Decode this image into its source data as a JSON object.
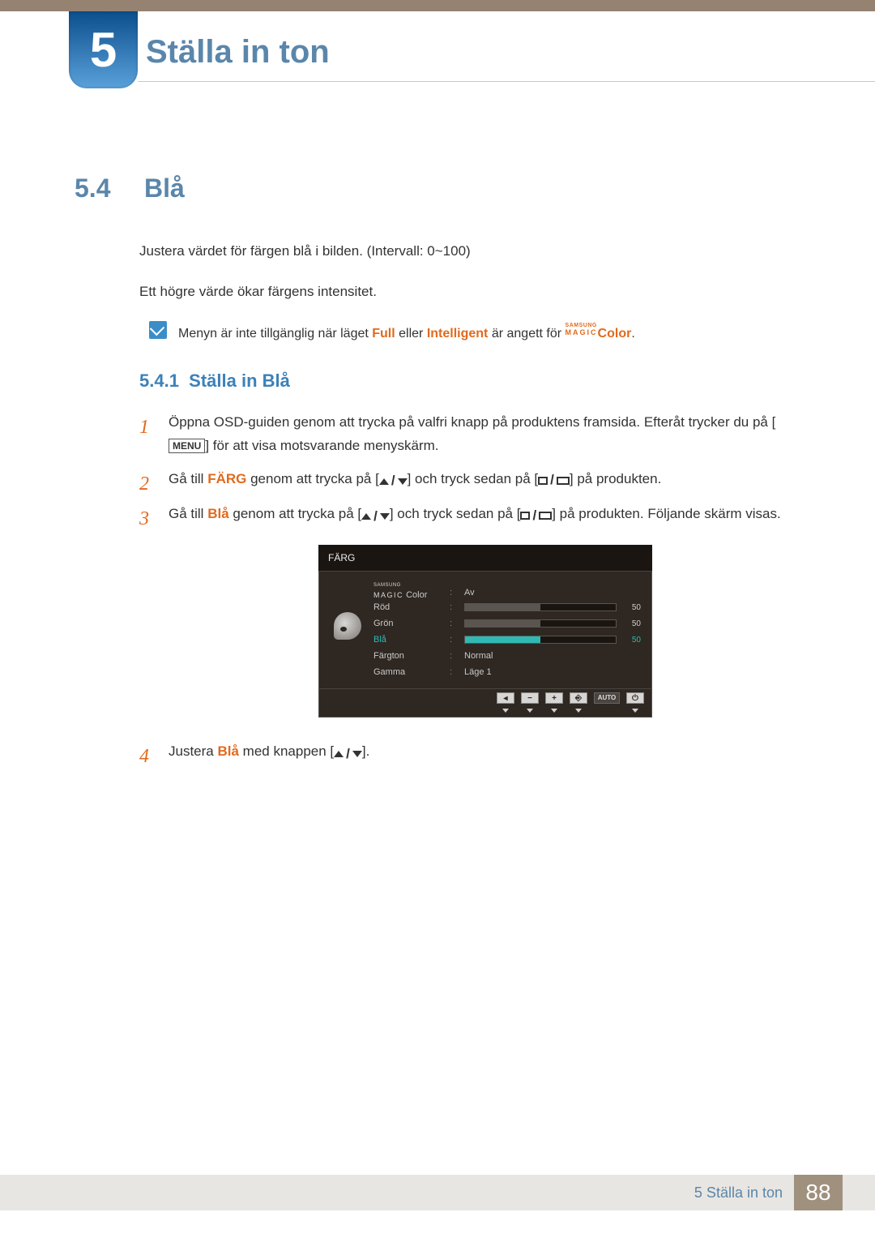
{
  "chapter": {
    "number": "5",
    "title": "Ställa in ton"
  },
  "section": {
    "number": "5.4",
    "title": "Blå"
  },
  "intro": {
    "p1": "Justera värdet för färgen blå i bilden. (Intervall: 0~100)",
    "p2": "Ett högre värde ökar färgens intensitet."
  },
  "note": {
    "pre": "Menyn är inte tillgänglig när läget ",
    "k1": "Full",
    "mid1": " eller ",
    "k2": "Intelligent",
    "mid2": " är angett för ",
    "brand_top": "SAMSUNG",
    "brand_bot": "MAGIC",
    "k3": "Color",
    "post": "."
  },
  "subsection": {
    "number": "5.4.1",
    "title": "Ställa in Blå"
  },
  "steps": {
    "s1a": "Öppna OSD-guiden genom att trycka på valfri knapp på produktens framsida. Efteråt trycker du på [",
    "s1_menu": "MENU",
    "s1b": "] för att visa motsvarande menyskärm.",
    "s2a": "Gå till ",
    "s2_k": "FÄRG",
    "s2b": " genom att trycka på [",
    "s2c": "] och tryck sedan på [",
    "s2d": "] på produkten.",
    "s3a": "Gå till ",
    "s3_k": "Blå",
    "s3b": " genom att trycka på [",
    "s3c": "] och tryck sedan på [",
    "s3d": "] på produkten. Följande skärm visas.",
    "s4a": "Justera ",
    "s4_k": "Blå",
    "s4b": " med knappen [",
    "s4c": "]."
  },
  "osd": {
    "title": "FÄRG",
    "magic_top": "SAMSUNG",
    "magic_bot": "MAGIC",
    "magic_suffix": " Color",
    "rows": {
      "magic_value": "Av",
      "red_label": "Röd",
      "red_val": "50",
      "green_label": "Grön",
      "green_val": "50",
      "blue_label": "Blå",
      "blue_val": "50",
      "tone_label": "Färgton",
      "tone_val": "Normal",
      "gamma_label": "Gamma",
      "gamma_val": "Läge 1"
    },
    "foot": {
      "back": "◂",
      "minus": "−",
      "plus": "+",
      "enter": "⎆",
      "auto": "AUTO",
      "power": "⏻"
    }
  },
  "footer": {
    "chapter_ref": "5 Ställa in ton",
    "page": "88"
  }
}
